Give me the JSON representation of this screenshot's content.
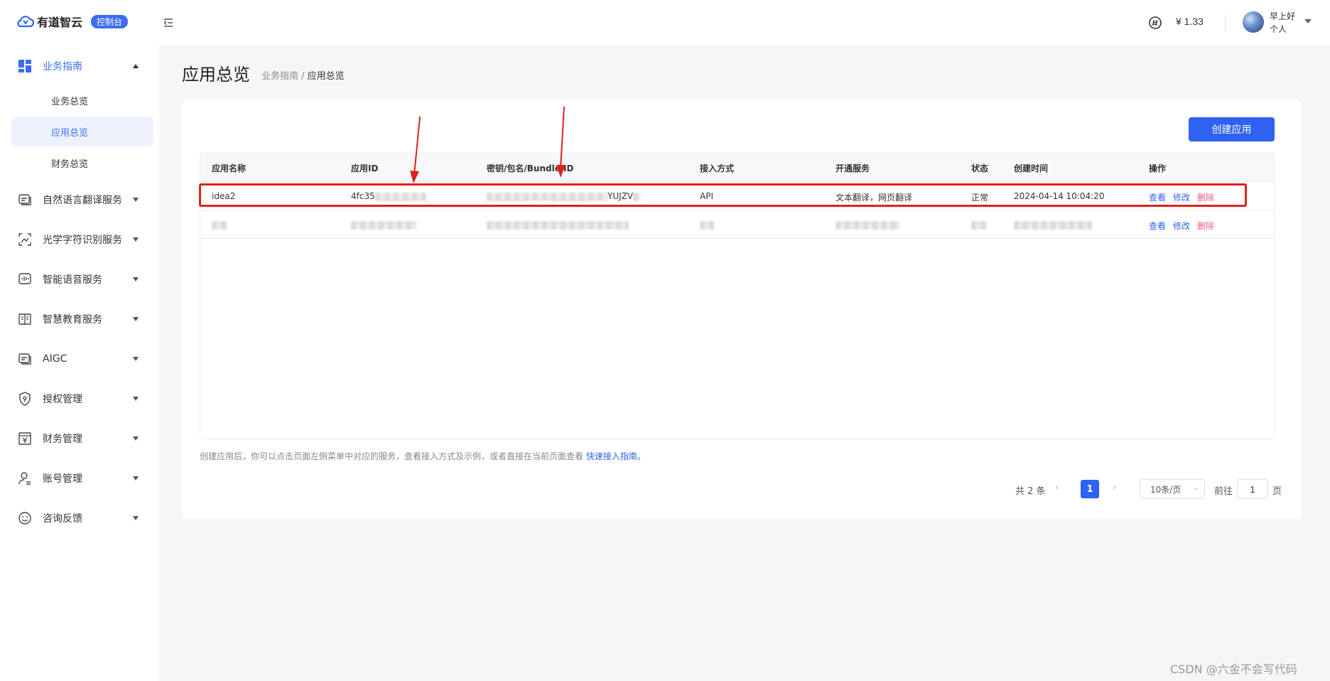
{
  "brand": {
    "name": "有道智云",
    "badge": "控制台"
  },
  "header": {
    "balance": "¥ 1.33",
    "greeting": "早上好",
    "user_type": "个人"
  },
  "sidebar": {
    "groups": [
      {
        "label": "业务指南",
        "icon": "dashboard-icon",
        "expanded": true,
        "active": true
      },
      {
        "label": "自然语言翻译服务",
        "icon": "translate-icon"
      },
      {
        "label": "光学字符识别服务",
        "icon": "ocr-icon"
      },
      {
        "label": "智能语音服务",
        "icon": "voice-icon"
      },
      {
        "label": "智慧教育服务",
        "icon": "education-icon"
      },
      {
        "label": "AIGC",
        "icon": "aigc-icon"
      },
      {
        "label": "授权管理",
        "icon": "shield-icon"
      },
      {
        "label": "财务管理",
        "icon": "finance-icon"
      },
      {
        "label": "账号管理",
        "icon": "account-icon"
      },
      {
        "label": "咨询反馈",
        "icon": "feedback-icon"
      }
    ],
    "subitems": [
      {
        "label": "业务总览"
      },
      {
        "label": "应用总览",
        "active": true
      },
      {
        "label": "财务总览"
      }
    ]
  },
  "page": {
    "title": "应用总览",
    "breadcrumb": {
      "parent": "业务指南",
      "separator": " / ",
      "current": "应用总览"
    },
    "create_button": "创建应用"
  },
  "table": {
    "columns": [
      "应用名称",
      "应用ID",
      "密钥/包名/Bundle ID",
      "接入方式",
      "开通服务",
      "状态",
      "创建时间",
      "操作"
    ],
    "rows": [
      {
        "name": "idea2",
        "app_id": "4fc35",
        "secret_tail": "YUJZV",
        "access": "API",
        "services": "文本翻译，网页翻译",
        "status": "正常",
        "created": "2024-04-14 10:04:20",
        "actions": [
          "查看",
          "修改",
          "删除"
        ]
      },
      {
        "name": "",
        "app_id": "",
        "secret_tail": "",
        "access": "",
        "services": "",
        "status": "",
        "created": "",
        "actions": [
          "查看",
          "修改",
          "删除"
        ]
      }
    ]
  },
  "hint": {
    "text": "创建应用后，你可以点击页面左侧菜单中对应的服务，查看接入方式及示例，或者直接在当前页面查看 ",
    "link": "快速接入指南。"
  },
  "pagination": {
    "total": "共 2 条",
    "current_page": "1",
    "page_size": "10条/页",
    "goto_label": "前往",
    "goto_value": "1",
    "goto_suffix": "页"
  },
  "watermark": "CSDN @六金不会写代码",
  "colors": {
    "accent": "#2e62f0",
    "danger": "#f5587a",
    "highlight": "#e0201c"
  }
}
